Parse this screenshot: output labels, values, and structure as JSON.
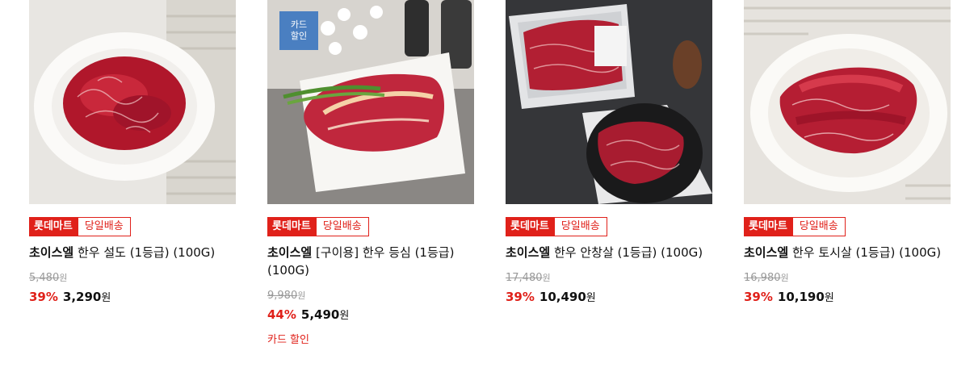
{
  "products": [
    {
      "mart_tag": "롯데마트",
      "delivery_tag": "당일배송",
      "brand": "초이스엘",
      "title": " 한우 설도 (1등급) (100G)",
      "original_price": "5,480",
      "original_unit": "원",
      "discount": "39%",
      "sale_price": "3,290",
      "sale_unit": "원"
    },
    {
      "card_badge_line1": "카드",
      "card_badge_line2": "할인",
      "mart_tag": "롯데마트",
      "delivery_tag": "당일배송",
      "brand": "초이스엘",
      "title": " [구이용] 한우 등심 (1등급) (100G)",
      "original_price": "9,980",
      "original_unit": "원",
      "discount": "44%",
      "sale_price": "5,490",
      "sale_unit": "원",
      "card_discount_note": "카드 할인"
    },
    {
      "mart_tag": "롯데마트",
      "delivery_tag": "당일배송",
      "brand": "초이스엘",
      "title": " 한우 안창살 (1등급) (100G)",
      "original_price": "17,480",
      "original_unit": "원",
      "discount": "39%",
      "sale_price": "10,490",
      "sale_unit": "원"
    },
    {
      "mart_tag": "롯데마트",
      "delivery_tag": "당일배송",
      "brand": "초이스엘",
      "title": " 한우 토시살 (1등급) (100G)",
      "original_price": "16,980",
      "original_unit": "원",
      "discount": "39%",
      "sale_price": "10,190",
      "sale_unit": "원"
    }
  ]
}
